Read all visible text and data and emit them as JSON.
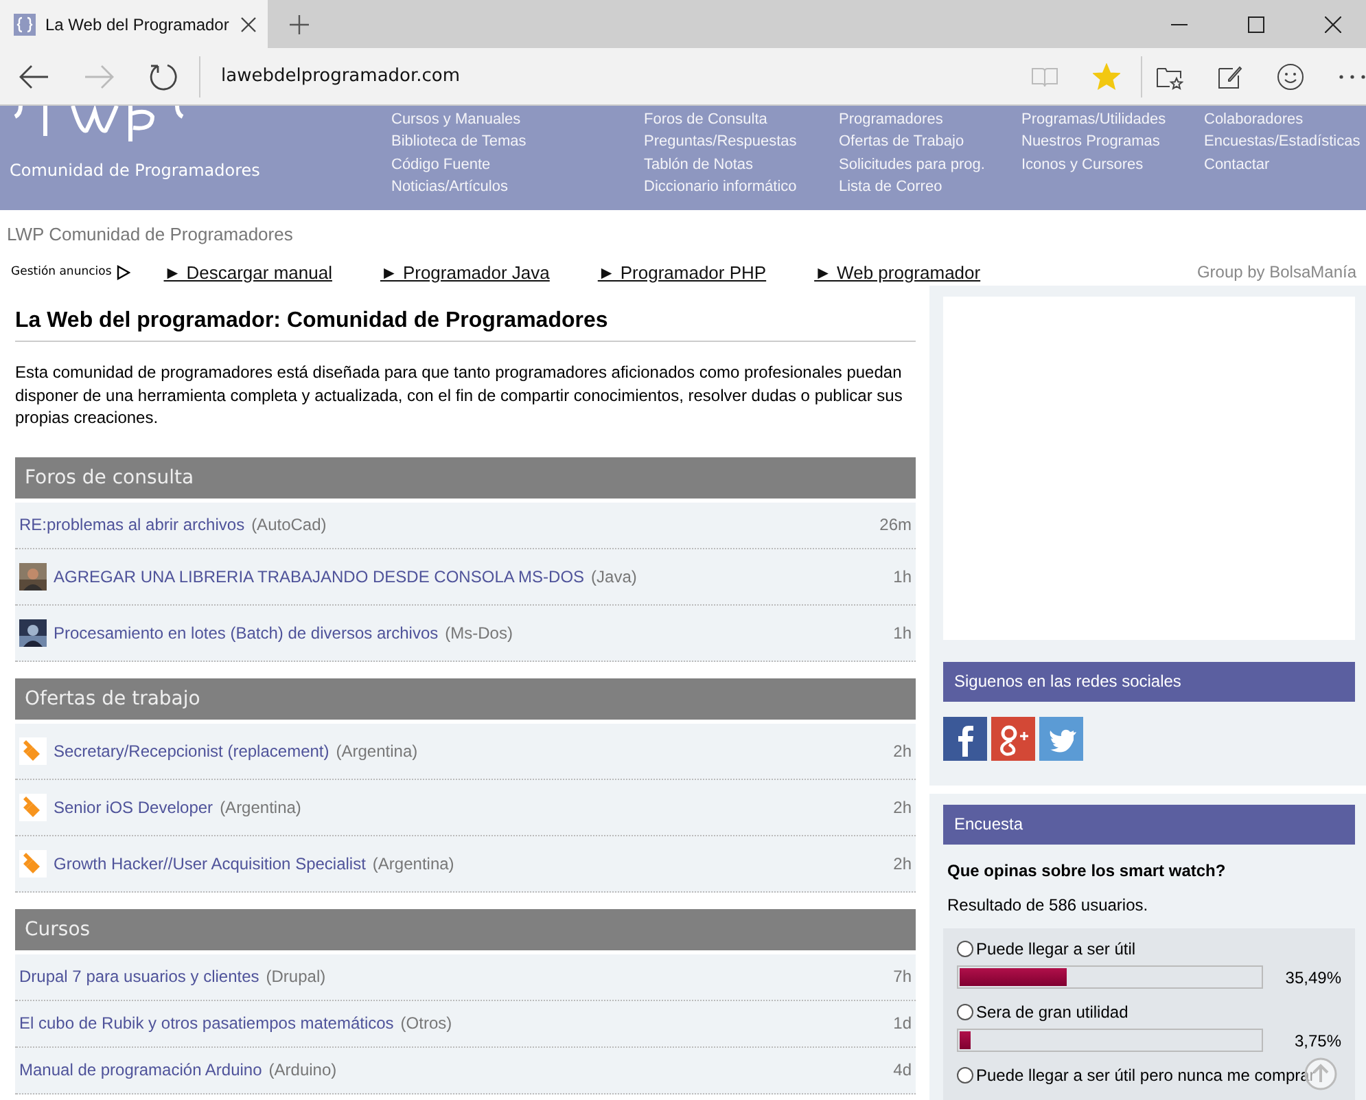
{
  "browser": {
    "tab_title": "La Web del Programador",
    "address": "lawebdelprogramador.com",
    "favorite": true
  },
  "header": {
    "tagline": "Comunidad de Programadores",
    "nav_columns": [
      [
        "Cursos y Manuales",
        "Biblioteca de Temas",
        "Código Fuente",
        "Noticias/Artículos"
      ],
      [
        "Foros de Consulta",
        "Preguntas/Respuestas",
        "Tablón de Notas",
        "Diccionario informático"
      ],
      [
        "Programadores",
        "Ofertas de Trabajo",
        "Solicitudes para prog.",
        "Lista de Correo"
      ],
      [
        "Programas/Utilidades",
        "Nuestros Programas",
        "Iconos y Cursores"
      ],
      [
        "Colaboradores",
        "Encuestas/Estadísticas",
        "Contactar"
      ]
    ]
  },
  "ad_bar": {
    "title": "LWP Comunidad de Programadores",
    "label": "Gestión anuncios",
    "links": [
      "► Descargar manual",
      "► Programador Java",
      "► Programador PHP",
      "► Web programador"
    ],
    "group": "Group by BolsaManía"
  },
  "intro": {
    "title": "La Web del programador: Comunidad de Programadores",
    "text": "Esta comunidad de programadores está diseñada para que tanto programadores aficionados como profesionales puedan disponer de una herramienta completa y actualizada, con el fin de compartir conocimientos, resolver dudas o publicar sus propias creaciones."
  },
  "sections": [
    {
      "title": "Foros de consulta",
      "rows": [
        {
          "kind": "plain",
          "title": "RE:problemas al abrir archivos",
          "tag": "(AutoCad)",
          "time": "26m"
        },
        {
          "kind": "avatar",
          "title": "AGREGAR UNA LIBRERIA TRABAJANDO DESDE CONSOLA MS-DOS",
          "tag": "(Java)",
          "time": "1h"
        },
        {
          "kind": "avatar",
          "title": "Procesamiento en lotes (Batch) de diversos archivos",
          "tag": "(Ms-Dos)",
          "time": "1h"
        }
      ]
    },
    {
      "title": "Ofertas de trabajo",
      "rows": [
        {
          "kind": "job",
          "title": "Secretary/Recepcionist (replacement)",
          "tag": "(Argentina)",
          "time": "2h"
        },
        {
          "kind": "job",
          "title": "Senior iOS Developer",
          "tag": "(Argentina)",
          "time": "2h"
        },
        {
          "kind": "job",
          "title": "Growth Hacker//User Acquisition Specialist",
          "tag": "(Argentina)",
          "time": "2h"
        }
      ]
    },
    {
      "title": "Cursos",
      "rows": [
        {
          "kind": "plain",
          "title": "Drupal 7 para usuarios y clientes",
          "tag": "(Drupal)",
          "time": "7h"
        },
        {
          "kind": "plain",
          "title": "El cubo de Rubik y otros pasatiempos matemáticos",
          "tag": "(Otros)",
          "time": "1d"
        },
        {
          "kind": "plain",
          "title": "Manual de programación Arduino",
          "tag": "(Arduino)",
          "time": "4d"
        }
      ]
    }
  ],
  "social": {
    "title": "Siguenos en las redes sociales",
    "networks": [
      {
        "kind": "facebook"
      },
      {
        "kind": "googleplus"
      },
      {
        "kind": "twitter"
      }
    ]
  },
  "poll": {
    "title": "Encuesta",
    "question": "Que opinas sobre los smart watch?",
    "summary": "Resultado de 586 usuarios.",
    "options": [
      {
        "label": "Puede llegar a ser útil",
        "selected": false,
        "level": 0.355,
        "reading": "35,49%"
      },
      {
        "label": "Sera de gran utilidad",
        "selected": false,
        "level": 0.0375,
        "reading": "3,75%"
      },
      {
        "label": "Puede llegar a ser útil pero nunca me comprar",
        "selected": false
      }
    ]
  }
}
